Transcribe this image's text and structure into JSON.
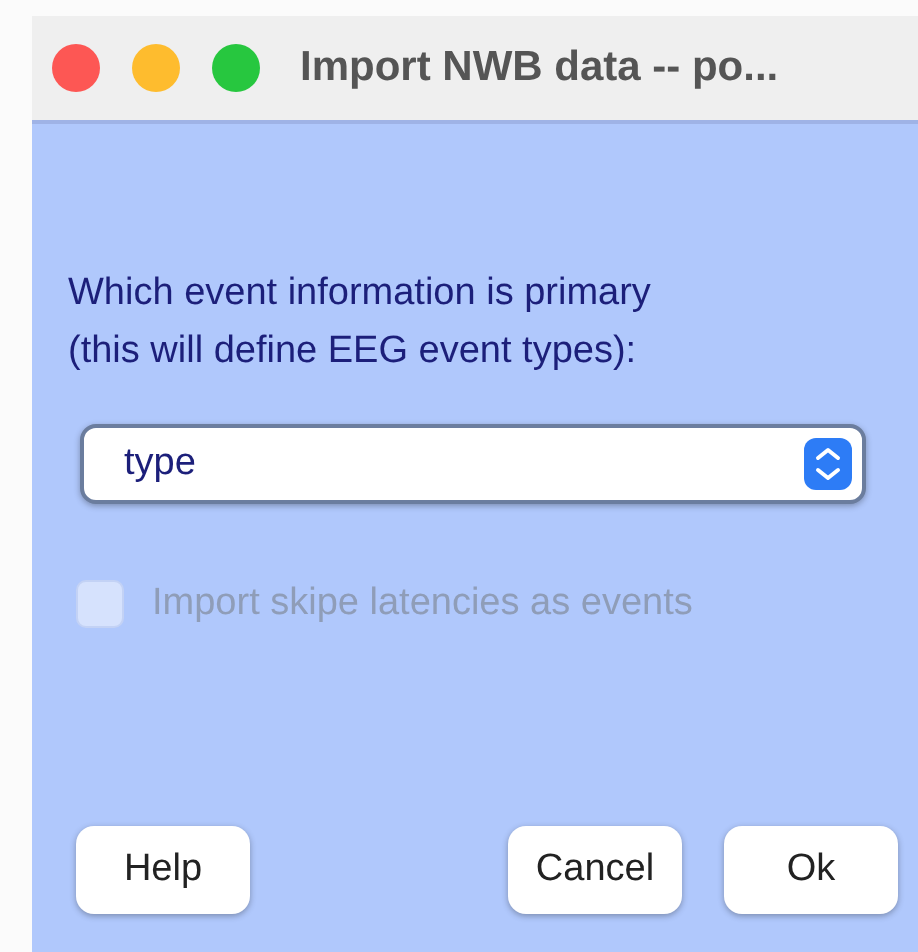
{
  "window": {
    "title": "Import NWB data -- po..."
  },
  "prompt": [
    "Which event information is primary",
    "(this will define EEG event types):"
  ],
  "dropdown": {
    "value": "type"
  },
  "checkbox": {
    "label": "Import skipe latencies as events",
    "checked": false,
    "disabled": true
  },
  "buttons": [
    {
      "label": "Help",
      "kind": "left"
    },
    {
      "label": "Cancel",
      "kind": "right"
    },
    {
      "label": "Ok",
      "kind": "right"
    }
  ]
}
